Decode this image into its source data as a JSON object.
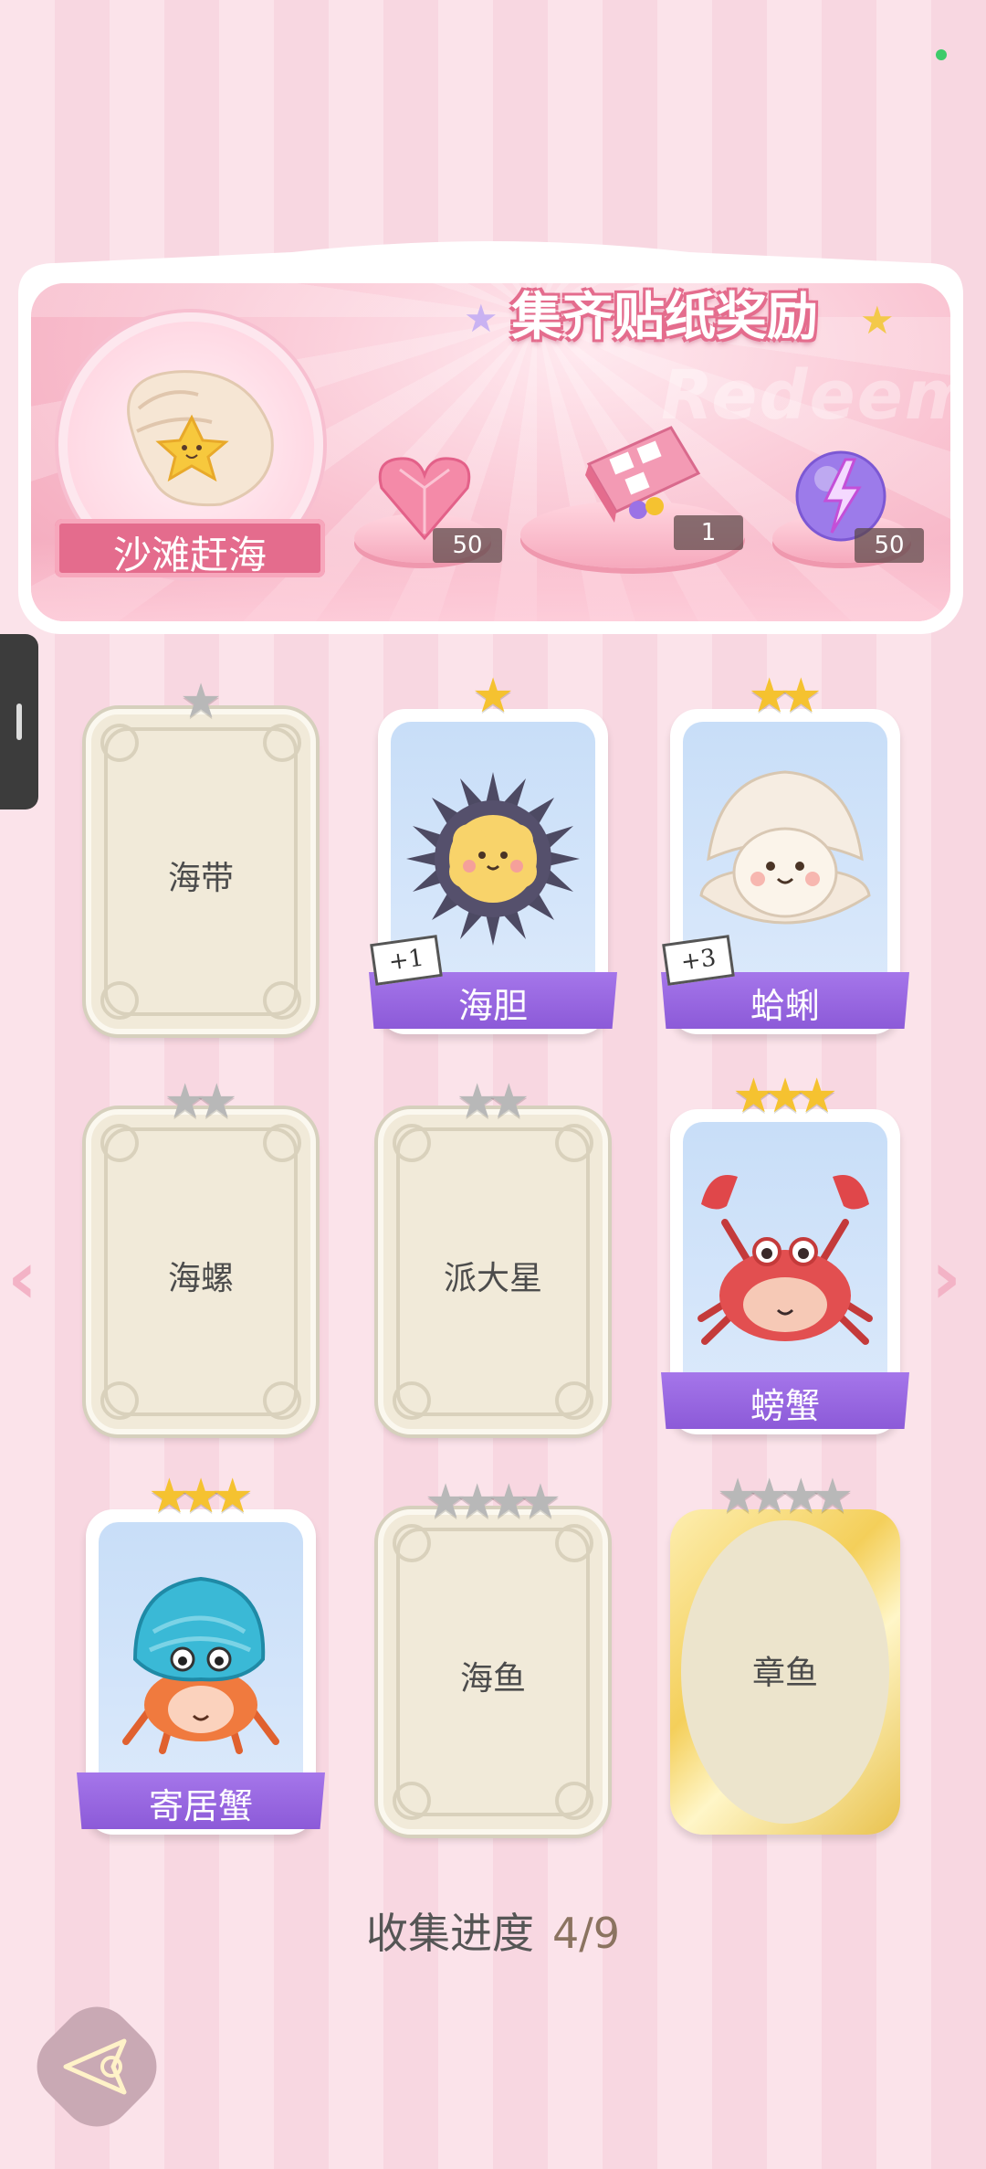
{
  "banner": {
    "title": "集齐贴纸奖励",
    "decor_word": "Redeem",
    "badge_label": "沙滩赶海",
    "rewards": [
      {
        "icon": "heart-gem-icon",
        "count": "50"
      },
      {
        "icon": "gift-box-icon",
        "count": "1"
      },
      {
        "icon": "lightning-orb-icon",
        "count": "50"
      }
    ]
  },
  "cards": [
    {
      "name": "海带",
      "state": "locked",
      "stars_total": 1,
      "stars_on": 0
    },
    {
      "name": "海胆",
      "state": "collected",
      "stars_total": 1,
      "stars_on": 1,
      "extra": "+1"
    },
    {
      "name": "蛤蜊",
      "state": "collected",
      "stars_total": 2,
      "stars_on": 2,
      "extra": "+3"
    },
    {
      "name": "海螺",
      "state": "locked",
      "stars_total": 2,
      "stars_on": 0
    },
    {
      "name": "派大星",
      "state": "locked",
      "stars_total": 2,
      "stars_on": 0
    },
    {
      "name": "螃蟹",
      "state": "collected",
      "stars_total": 3,
      "stars_on": 3
    },
    {
      "name": "寄居蟹",
      "state": "collected",
      "stars_total": 3,
      "stars_on": 3
    },
    {
      "name": "海鱼",
      "state": "locked",
      "stars_total": 4,
      "stars_on": 0
    },
    {
      "name": "章鱼",
      "state": "locked-gold",
      "stars_total": 4,
      "stars_on": 0
    }
  ],
  "progress": {
    "label": "收集进度",
    "value": "4/9"
  },
  "nav": {
    "prev_glyph": "‹",
    "next_glyph": "›"
  },
  "colors": {
    "ribbon": "#9a68e2",
    "star_on": "#f5c230",
    "star_off": "#b8b8b8",
    "accent_pink": "#e46c8d"
  }
}
